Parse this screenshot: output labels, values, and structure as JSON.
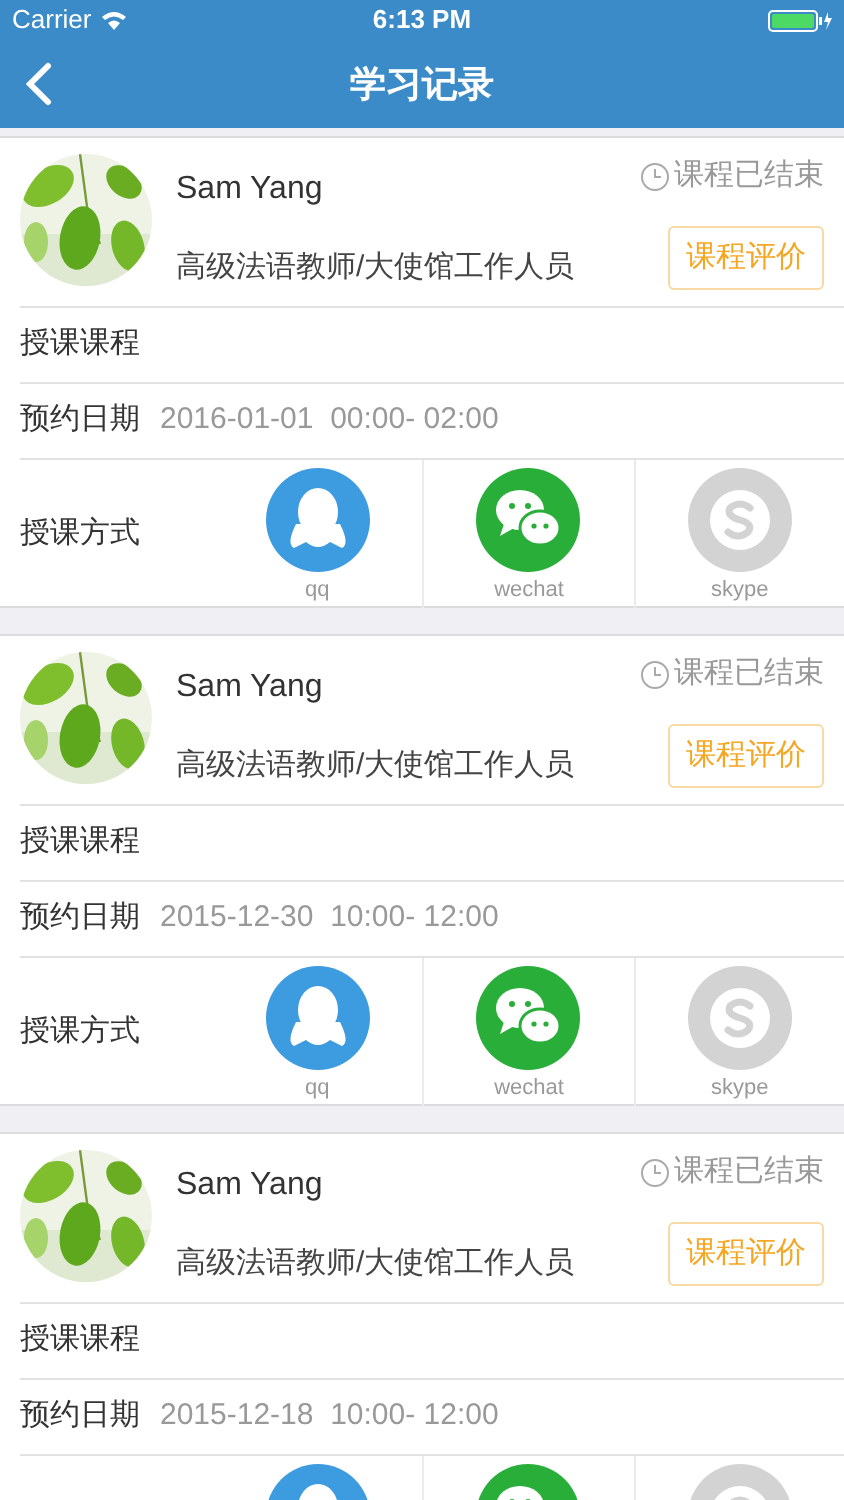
{
  "status_bar": {
    "carrier": "Carrier",
    "time": "6:13 PM"
  },
  "nav": {
    "title": "学习记录"
  },
  "records": [
    {
      "name": "Sam Yang",
      "title": "高级法语教师/大使馆工作人员",
      "status": "课程已结束",
      "review_button": "课程评价",
      "course_label": "授课课程",
      "date_label": "预约日期",
      "date": "2016-01-01  00:00- 02:00",
      "method_label": "授课方式",
      "methods": [
        {
          "kind": "qq",
          "label": "qq",
          "enabled": true
        },
        {
          "kind": "wechat",
          "label": "wechat",
          "enabled": true
        },
        {
          "kind": "skype",
          "label": "skype",
          "enabled": false
        }
      ]
    },
    {
      "name": "Sam Yang",
      "title": "高级法语教师/大使馆工作人员",
      "status": "课程已结束",
      "review_button": "课程评价",
      "course_label": "授课课程",
      "date_label": "预约日期",
      "date": "2015-12-30  10:00- 12:00",
      "method_label": "授课方式",
      "methods": [
        {
          "kind": "qq",
          "label": "qq",
          "enabled": true
        },
        {
          "kind": "wechat",
          "label": "wechat",
          "enabled": true
        },
        {
          "kind": "skype",
          "label": "skype",
          "enabled": false
        }
      ]
    },
    {
      "name": "Sam Yang",
      "title": "高级法语教师/大使馆工作人员",
      "status": "课程已结束",
      "review_button": "课程评价",
      "course_label": "授课课程",
      "date_label": "预约日期",
      "date": "2015-12-18  10:00- 12:00",
      "methods": [
        {
          "kind": "qq",
          "enabled": true
        },
        {
          "kind": "wechat",
          "enabled": true
        },
        {
          "kind": "skype",
          "enabled": false
        }
      ]
    }
  ]
}
